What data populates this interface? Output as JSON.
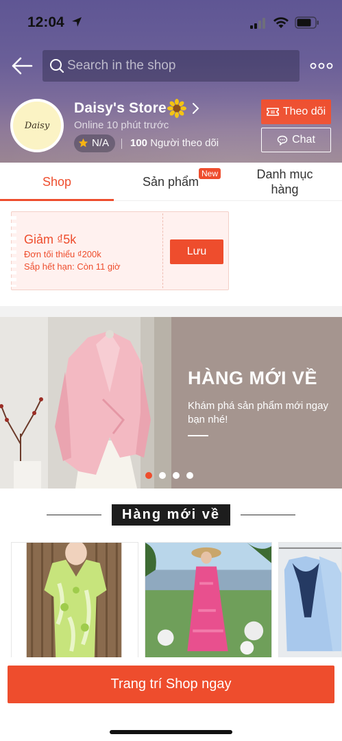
{
  "status_bar": {
    "time": "12:04"
  },
  "search": {
    "placeholder": "Search in the shop"
  },
  "shop": {
    "avatar_text": "Daisy",
    "name": "Daisy's Store",
    "online_status": "Online 10 phút trước",
    "rating": "N/A",
    "followers_count": "100",
    "followers_label": "Người theo dõi",
    "follow_label": "Theo dõi",
    "chat_label": "Chat"
  },
  "tabs": [
    {
      "label": "Shop",
      "active": true
    },
    {
      "label": "Sản phẩm",
      "badge": "New"
    },
    {
      "label": "Danh mục hàng"
    }
  ],
  "voucher": {
    "title": "Giảm ₫5k",
    "min_order": "Đơn tối thiểu ₫200k",
    "expiry": "Sắp hết hạn: Còn 11 giờ",
    "save_label": "Lưu"
  },
  "banner": {
    "headline": "HÀNG MỚI VỀ",
    "subtitle": "Khám phá sản phẩm mới ngay bạn nhé!",
    "slide_count": 4,
    "active_slide": 1
  },
  "new_arrivals": {
    "title": "Hàng mới về"
  },
  "bottom_action": {
    "label": "Trang trí Shop ngay"
  },
  "colors": {
    "accent": "#ee4d2d",
    "header": "#6a5f98",
    "banner": "#a5958f"
  }
}
